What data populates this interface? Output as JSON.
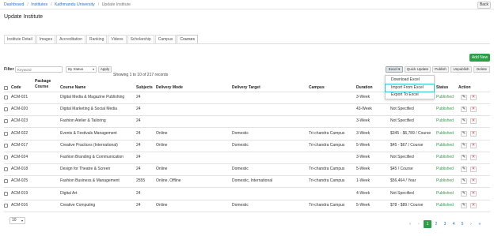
{
  "breadcrumb": [
    "Dashboard",
    "Institutes",
    "Kathmandu University",
    "Update Institute"
  ],
  "header": {
    "back_label": "Back",
    "title": "Update Institute"
  },
  "tabs": [
    "Institute Detail",
    "Images",
    "Accreditation",
    "Ranking",
    "Videos",
    "Scholarship",
    "Campus",
    "Courses"
  ],
  "active_tab": "Courses",
  "add_new_label": "Add New",
  "filter": {
    "label": "Filter",
    "keyword_placeholder": "Keyword",
    "status_value": "By Status",
    "apply_label": "Apply"
  },
  "showing_text": "Showing 1 to 10 of 217 records",
  "toolbar": {
    "excel_label": "Excel ▾",
    "quick_update_label": "Quick Update",
    "publish_label": "Publish",
    "unpublish_label": "Unpublish",
    "delete_label": "Delete"
  },
  "excel_menu": [
    "Download Excel Template",
    "Import From Excel",
    "Export To Excel"
  ],
  "columns": {
    "code": "Code",
    "package_course": "Package Course",
    "course_name": "Course Name",
    "subjects": "Subjects",
    "delivery_mode": "Delivery Mode",
    "delivery_target": "Delivery Target",
    "campus": "Campus",
    "duration": "Duration",
    "status": "Status",
    "action": "Action"
  },
  "rows": [
    {
      "code": "ACM-021",
      "name": "Digital Media & Magazine Publishing",
      "subjects": "24",
      "mode": "",
      "target": "",
      "campus": "",
      "duration": "3-Week",
      "fee": "Not Specified",
      "status": "Published"
    },
    {
      "code": "ACM-020",
      "name": "Digital Marketing & Social Media",
      "subjects": "24",
      "mode": "",
      "target": "",
      "campus": "",
      "duration": "43-Week",
      "fee": "Not Specified",
      "status": "Published"
    },
    {
      "code": "ACM-023",
      "name": "Fashion Atelier & Tailoring",
      "subjects": "24",
      "mode": "",
      "target": "",
      "campus": "",
      "duration": "3-Week",
      "fee": "Not Specified",
      "status": "Published"
    },
    {
      "code": "ACM-022",
      "name": "Events & Festivals Management",
      "subjects": "24",
      "mode": "Online",
      "target": "Domestic",
      "campus": "Tri-chandra Campus",
      "duration": "3-Week",
      "fee": "$345 - $6,789 / Course",
      "status": "Published"
    },
    {
      "code": "ACM-017",
      "name": "Creative Practices (International)",
      "subjects": "24",
      "mode": "Online",
      "target": "Domestic",
      "campus": "Tri-chandra Campus",
      "duration": "5-Week",
      "fee": "$45 - $67 / Course",
      "status": "Published"
    },
    {
      "code": "ACM-024",
      "name": "Fashion Branding & Communication",
      "subjects": "24",
      "mode": "",
      "target": "",
      "campus": "",
      "duration": "3-Week",
      "fee": "Not Specified",
      "status": "Published"
    },
    {
      "code": "ACM-018",
      "name": "Design for Theatre & Screen",
      "subjects": "24",
      "mode": "Online",
      "target": "Domestic",
      "campus": "Tri-chandra Campus",
      "duration": "5-Week",
      "fee": "$45 / Course",
      "status": "Published"
    },
    {
      "code": "ACM-025",
      "name": "Fashion Business & Management",
      "subjects": "2555",
      "mode": "Online, Offline",
      "target": "Domestic, International",
      "campus": "Tri-chandra Campus",
      "duration": "1-Week",
      "fee": "$56,464 / Year",
      "status": "Published"
    },
    {
      "code": "ACM-019",
      "name": "Digital Art",
      "subjects": "24",
      "mode": "",
      "target": "",
      "campus": "",
      "duration": "4-Week",
      "fee": "Not Specified",
      "status": "Published"
    },
    {
      "code": "ACM-016",
      "name": "Creative Computing",
      "subjects": "24",
      "mode": "Online",
      "target": "Domestic",
      "campus": "Tri-chandra Campus",
      "duration": "5-Week",
      "fee": "$78 - $89 / Course",
      "status": "Published"
    }
  ],
  "page_size": "10",
  "pagination": [
    "«",
    "‹",
    "1",
    "2",
    "3",
    "4",
    "5",
    "›",
    "»"
  ],
  "current_page": "1",
  "colors": {
    "accent_green": "#2e9d47",
    "link_blue": "#2a6fc4",
    "menu_highlight": "#35c6d4"
  },
  "icons": {
    "edit": "pencil-icon",
    "delete": "close-icon"
  }
}
